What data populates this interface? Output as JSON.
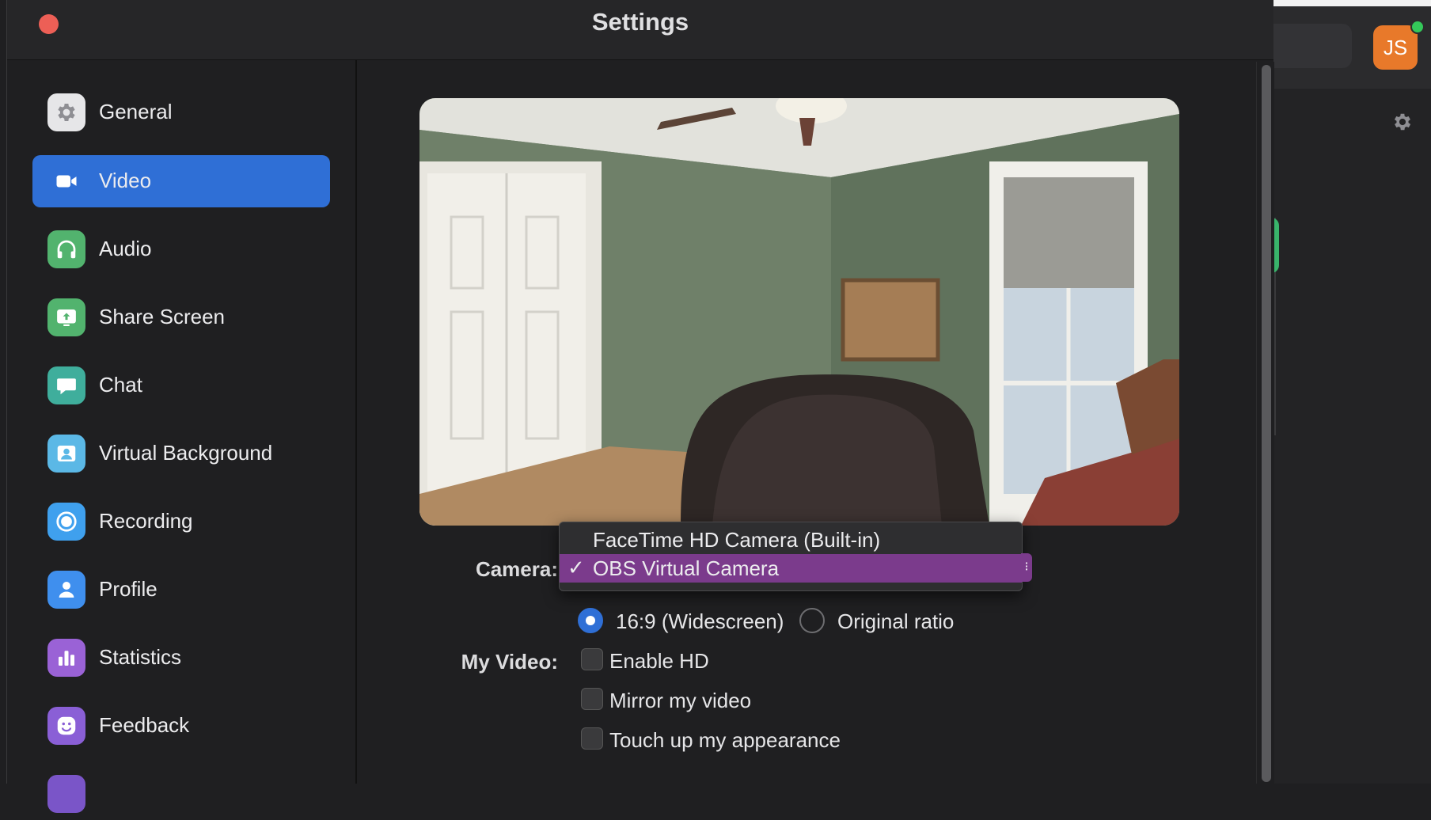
{
  "window": {
    "title": "Settings"
  },
  "background_app": {
    "avatar_initials": "JS",
    "colors": {
      "avatar": "#e8792a",
      "online": "#34c759"
    }
  },
  "sidebar": {
    "items": [
      {
        "label": "General",
        "icon": "gear-icon",
        "color": "#e6e6e8",
        "active": false
      },
      {
        "label": "Video",
        "icon": "video-camera-icon",
        "color": "#2f6fd6",
        "active": true
      },
      {
        "label": "Audio",
        "icon": "headphones-icon",
        "color": "#52b36e",
        "active": false
      },
      {
        "label": "Share Screen",
        "icon": "share-screen-icon",
        "color": "#52b36e",
        "active": false
      },
      {
        "label": "Chat",
        "icon": "chat-bubble-icon",
        "color": "#3fae9c",
        "active": false
      },
      {
        "label": "Virtual Background",
        "icon": "person-frame-icon",
        "color": "#5bb8e6",
        "active": false
      },
      {
        "label": "Recording",
        "icon": "record-icon",
        "color": "#3fa0ee",
        "active": false
      },
      {
        "label": "Profile",
        "icon": "person-icon",
        "color": "#3f8fee",
        "active": false
      },
      {
        "label": "Statistics",
        "icon": "bar-chart-icon",
        "color": "#9a62d6",
        "active": false
      },
      {
        "label": "Feedback",
        "icon": "smiley-icon",
        "color": "#8a5fd6",
        "active": false
      }
    ]
  },
  "video": {
    "camera_label": "Camera:",
    "camera_options": [
      {
        "label": "FaceTime HD Camera (Built-in)",
        "selected": false
      },
      {
        "label": "OBS Virtual Camera",
        "selected": true
      }
    ],
    "check_mark": "✓",
    "ratio_options": [
      {
        "label": "16:9 (Widescreen)",
        "selected": true
      },
      {
        "label": "Original ratio",
        "selected": false
      }
    ],
    "my_video_label": "My Video:",
    "checkboxes": [
      {
        "label": "Enable HD",
        "checked": false
      },
      {
        "label": "Mirror my video",
        "checked": false
      },
      {
        "label": "Touch up my appearance",
        "checked": false
      }
    ],
    "accent_color": "#2f6fd6",
    "highlight_color": "#7b3b8c"
  }
}
